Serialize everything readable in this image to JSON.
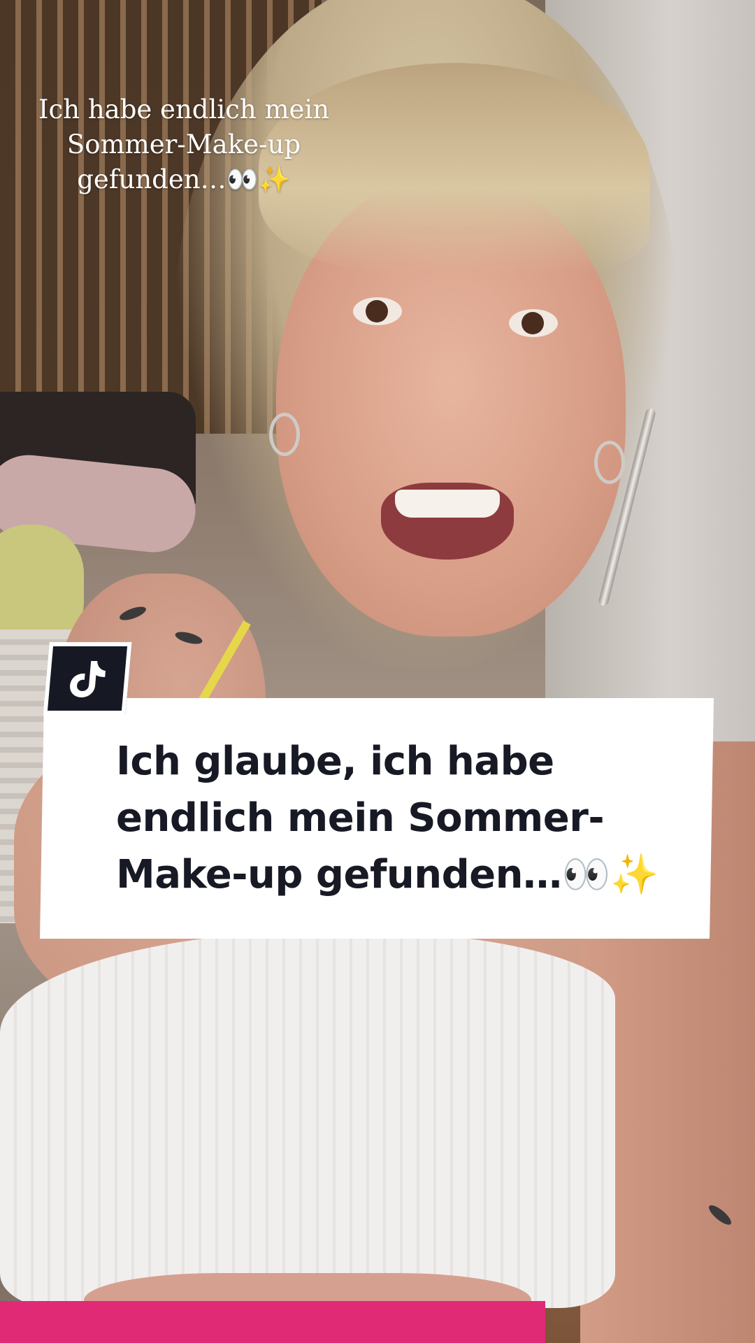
{
  "video": {
    "top_caption": "Ich habe endlich mein Sommer-Make-up gefunden…👀✨",
    "main_caption": "Ich glaube, ich habe endlich mein Sommer-Make-up gefunden…👀✨"
  },
  "icons": {
    "logo": "tiktok-logo-icon"
  },
  "colors": {
    "card_background": "#ffffff",
    "caption_text": "#171a24",
    "badge_background": "#161923"
  }
}
